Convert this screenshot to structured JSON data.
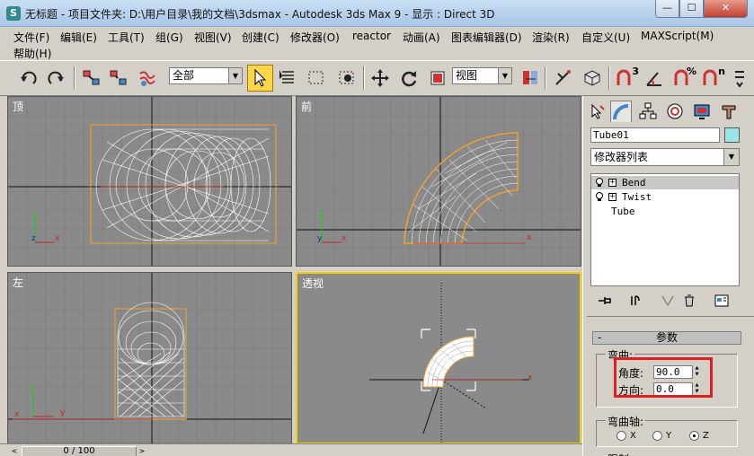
{
  "window": {
    "title": "无标题    - 项目文件夹: D:\\用户目录\\我的文档\\3dsmax    - Autodesk 3ds Max 9    - 显示 : Direct 3D",
    "logo": "S",
    "min_icon": "—",
    "max_icon": "☐",
    "close_icon": "✕"
  },
  "menu": [
    "文件(F)",
    "编辑(E)",
    "工具(T)",
    "组(G)",
    "视图(V)",
    "创建(C)",
    "修改器(O)",
    "reactor",
    "动画(A)",
    "图表编辑器(D)",
    "渲染(R)",
    "自定义(U)",
    "MAXScript(M)",
    "帮助(H)"
  ],
  "toolbar": {
    "selection_filter": "全部",
    "ref_coord": "视图",
    "snap_3": "3",
    "snap_percent": "%",
    "snap_n": "n"
  },
  "viewports": {
    "top": "顶",
    "front": "前",
    "left": "左",
    "perspective": "透视"
  },
  "axes": {
    "x": "x",
    "y": "y",
    "z": "z"
  },
  "timeline": {
    "frame": "0 / 100",
    "prev": "<",
    "next": ">"
  },
  "panel": {
    "object_name": "Tube01",
    "object_color": "#99e6e6",
    "modifier_list": "修改器列表",
    "stack": [
      "Bend",
      "Twist",
      "Tube"
    ],
    "stack_plus": "+",
    "rollout_toggle": "-",
    "rollout_title": "参数",
    "bend_group": "弯曲:",
    "angle_label": "角度:",
    "angle_value": "90.0",
    "direction_label": "方向:",
    "direction_value": "0.0",
    "axis_group": "弯曲轴:",
    "axis_options": [
      "X",
      "Y",
      "Z"
    ],
    "axis_selected": "Z",
    "limits_label": "限制"
  },
  "colors": {
    "viewport_bg": "#8a8a8a",
    "wire": "#ffffff",
    "bbox": "#f0a030",
    "active_border": "#f0d200",
    "highlight": "#e02020"
  }
}
